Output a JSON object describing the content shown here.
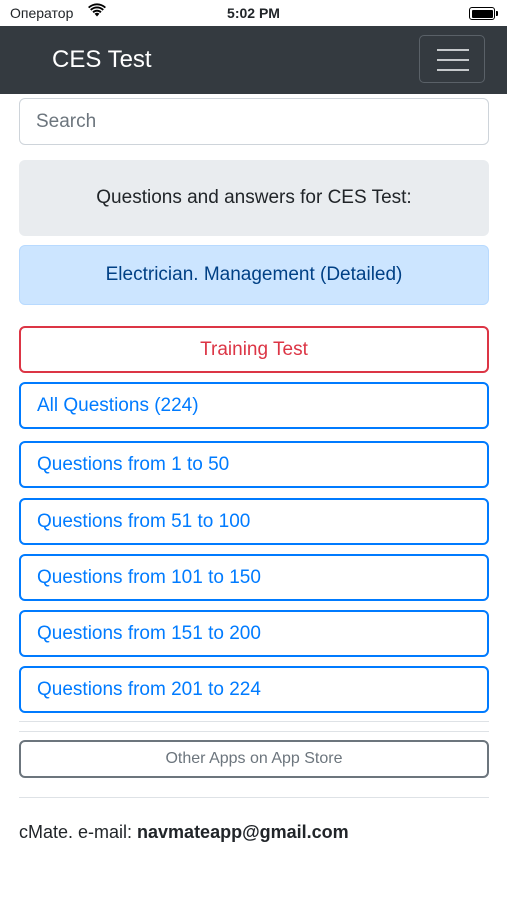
{
  "status_bar": {
    "carrier": "Оператор",
    "time": "5:02 PM"
  },
  "navbar": {
    "title": "CES Test"
  },
  "search": {
    "placeholder": "Search"
  },
  "intro": "Questions and answers for CES Test:",
  "topic": "Electrician. Management (Detailed)",
  "training_button": "Training Test",
  "question_buttons": [
    "All Questions (224)",
    "Questions from 1 to 50",
    "Questions from 51 to 100",
    "Questions from 101 to 150",
    "Questions from 151 to 200",
    "Questions from 201 to 224"
  ],
  "other_apps_button": "Other Apps on App Store",
  "footer": {
    "prefix": "cMate. e-mail: ",
    "email": "navmateapp@gmail.com"
  },
  "colors": {
    "navbar": "#343a40",
    "primary": "#007bff",
    "danger": "#dc3545",
    "secondary": "#6c757d",
    "topic_bg": "#cce5ff",
    "intro_bg": "#e9ecef"
  }
}
